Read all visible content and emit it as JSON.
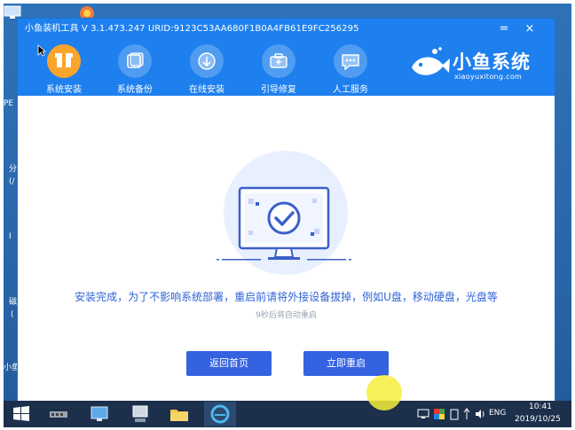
{
  "window": {
    "title": "小鱼装机工具 V 3.1.473.247 URID:9123C53AA680F1B0A4FB61E9FC256295",
    "minimize_label": "=",
    "close_label": "×"
  },
  "nav": {
    "items": [
      {
        "label": "系统安装",
        "icon": "box-icon",
        "active": true
      },
      {
        "label": "系统备份",
        "icon": "backup-icon",
        "active": false
      },
      {
        "label": "在线安装",
        "icon": "download-icon",
        "active": false
      },
      {
        "label": "引导修复",
        "icon": "toolbox-icon",
        "active": false
      },
      {
        "label": "人工服务",
        "icon": "chat-icon",
        "active": false
      }
    ]
  },
  "brand": {
    "name": "小鱼系统",
    "url": "xiaoyuxitong.com"
  },
  "main": {
    "message": "安装完成，为了不影响系统部署，重启前请将外接设备拔掉，例如U盘，移动硬盘，光盘等",
    "countdown": "9秒后将自动重启",
    "back_button": "返回首页",
    "restart_button": "立即重启"
  },
  "desktop": {
    "side_labels": [
      "PE",
      "分",
      "(/",
      "I",
      "磁",
      "(",
      "小鱼"
    ]
  },
  "taskbar": {
    "language": "ENG",
    "time": "10:41",
    "date": "2019/10/25"
  },
  "colors": {
    "accent": "#1e80ee",
    "active_tab": "#f9a42a",
    "button": "#3462e0",
    "message_text": "#2f63d6"
  }
}
